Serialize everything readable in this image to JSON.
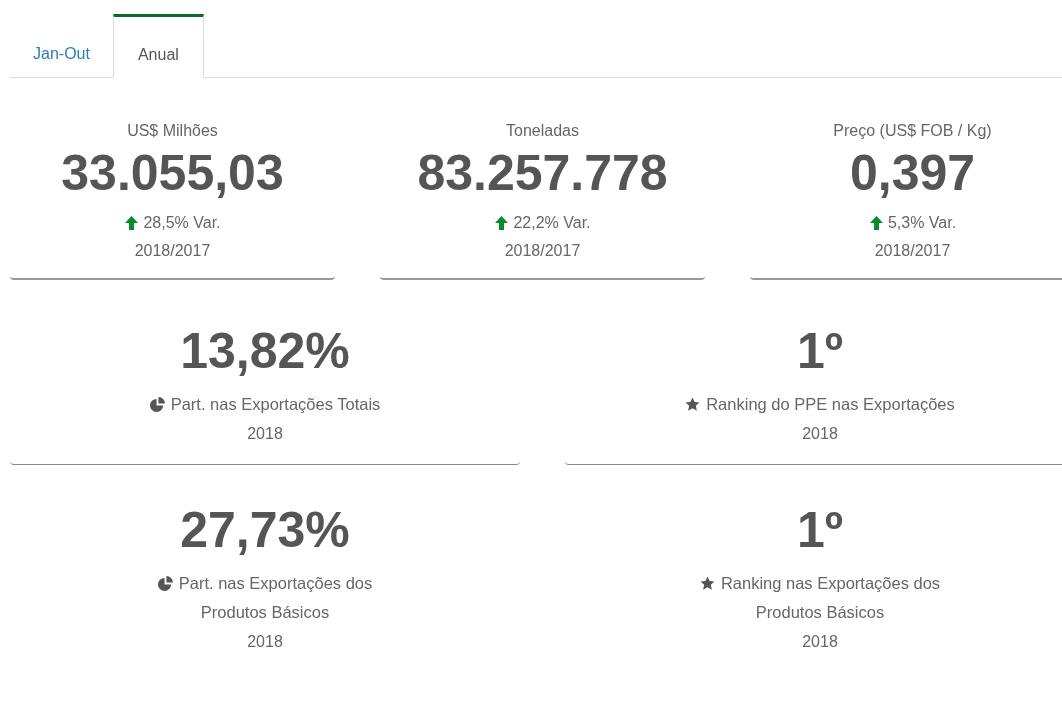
{
  "tabs": [
    {
      "label": "Jan-Out",
      "selected": false
    },
    {
      "label": "Anual",
      "selected": true
    }
  ],
  "summary_cards": [
    {
      "label": "US$ Milhões",
      "value": "33.055,03",
      "rising": true,
      "change": "28,5% Var.",
      "period": "2018/2017"
    },
    {
      "label": "Toneladas",
      "value": "83.257.778",
      "rising": true,
      "change": "22,2% Var.",
      "period": "2018/2017"
    },
    {
      "label": "Preço (US$ FOB / Kg)",
      "value": "0,397",
      "rising": true,
      "change": "5,3% Var.",
      "period": "2018/2017"
    }
  ],
  "stat_rows": [
    {
      "cards": [
        {
          "value": "13,82%",
          "kind": "pie",
          "label": "Part. nas Exportações Totais",
          "period": "2018"
        },
        {
          "value": "1º",
          "kind": "star",
          "label": "Ranking do PPE nas Exportações",
          "period": "2018"
        }
      ]
    },
    {
      "cards": [
        {
          "value": "27,73%",
          "kind": "pie",
          "label": "Part. nas Exportações dos Produtos Básicos",
          "period": "2018"
        },
        {
          "value": "1º",
          "kind": "star",
          "label": "Ranking nas Exportações dos Produtos Básicos",
          "period": "2018"
        }
      ]
    }
  ]
}
